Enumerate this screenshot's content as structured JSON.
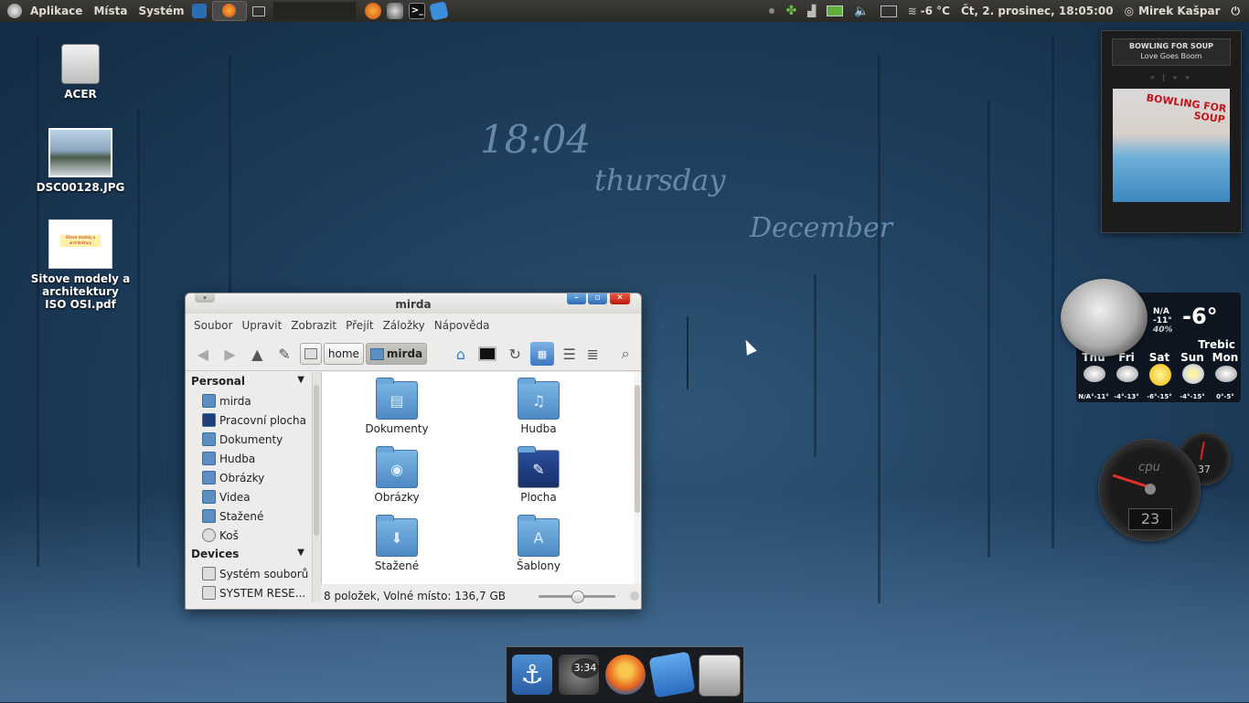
{
  "panel": {
    "menus": [
      "Aplikace",
      "Místa",
      "Systém"
    ],
    "temperature": "-6 °C",
    "datetime": "Čt, 2. prosinec, 18:05:00",
    "user": "Mirek Kašpar"
  },
  "desktop": {
    "icons": [
      {
        "label": "ACER"
      },
      {
        "label": "DSC00128.JPG"
      },
      {
        "label": "Sitove modely a architektury ISO OSI.pdf",
        "thumb_text": "Sitove modely a architektury"
      }
    ],
    "clock_time": "18:04",
    "clock_day": "thursday",
    "clock_month": "December"
  },
  "window": {
    "title": "mirda",
    "menu": [
      "Soubor",
      "Upravit",
      "Zobrazit",
      "Přejít",
      "Záložky",
      "Nápověda"
    ],
    "breadcrumb": [
      "home",
      "mirda"
    ],
    "sidebar": {
      "personal_header": "Personal",
      "personal_items": [
        "mirda",
        "Pracovní plocha",
        "Dokumenty",
        "Hudba",
        "Obrázky",
        "Videa",
        "Stažené",
        "Koš"
      ],
      "devices_header": "Devices",
      "device_items": [
        "Systém souborů",
        "SYSTEM RESE..."
      ]
    },
    "folders": [
      {
        "label": "Dokumenty",
        "icon": "document-folder-icon"
      },
      {
        "label": "Hudba",
        "icon": "music-folder-icon"
      },
      {
        "label": "Obrázky",
        "icon": "pictures-folder-icon"
      },
      {
        "label": "Plocha",
        "icon": "desktop-folder-icon"
      },
      {
        "label": "Stažené",
        "icon": "downloads-folder-icon"
      },
      {
        "label": "Šablony",
        "icon": "templates-folder-icon"
      }
    ],
    "status": "8 položek, Volné místo: 136,7 GB",
    "zoom_level": 0.5
  },
  "music_widget": {
    "artist": "BOWLING FOR SOUP",
    "track": "Love Goes Boom",
    "controls": "«   | »   »",
    "cover_text": "BOWLING FOR SOUP"
  },
  "weather_widget": {
    "current_temp": "-6°",
    "current_info": [
      "N/A",
      "-11°",
      "40%"
    ],
    "city": "Trebic",
    "days": [
      {
        "name": "Thu",
        "temps": "N/A°-11°"
      },
      {
        "name": "Fri",
        "temps": "-4°-13°"
      },
      {
        "name": "Sat",
        "temps": "-6°-15°"
      },
      {
        "name": "Sun",
        "temps": "-4°-15°"
      },
      {
        "name": "Mon",
        "temps": "0°-5°"
      }
    ]
  },
  "cpu_widget": {
    "label": "cpu",
    "value": "23",
    "small_value": "37"
  },
  "dock": {
    "clock": "3:34"
  }
}
